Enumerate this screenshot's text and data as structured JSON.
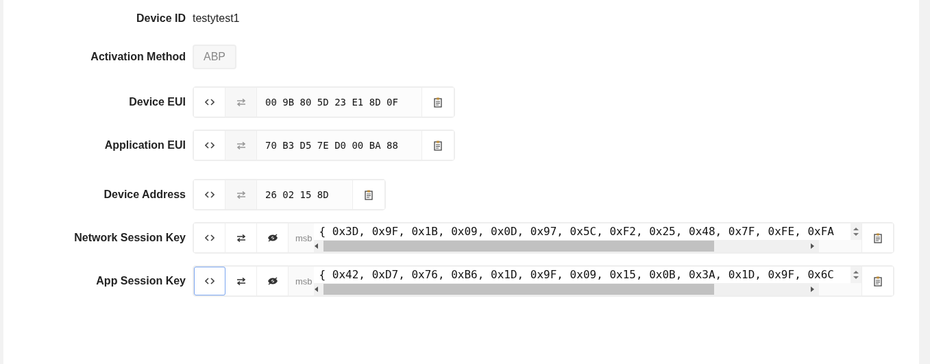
{
  "sections": [
    [
      {
        "kind": "text",
        "label": "Device ID",
        "value": "testytest1"
      }
    ],
    [
      {
        "kind": "badge",
        "label": "Activation Method",
        "value": "ABP",
        "disabled": true
      }
    ],
    [
      {
        "kind": "hex",
        "label": "Device EUI",
        "value": "00 9B 80 5D 23 E1 8D 0F"
      },
      {
        "kind": "hex",
        "label": "Application EUI",
        "value": "70 B3 D5 7E D0 00 BA 88"
      }
    ],
    [
      {
        "kind": "hex",
        "label": "Device Address",
        "value": "26 02 15 8D"
      },
      {
        "kind": "key",
        "label": "Network Session Key",
        "order": "msb",
        "value": "{ 0x3D, 0x9F, 0x1B, 0x09, 0x0D, 0x97, 0x5C, 0xF2, 0x25, 0x48, 0x7F, 0xFE, 0xFA",
        "focused": false
      },
      {
        "kind": "key",
        "label": "App Session Key",
        "order": "msb",
        "value": "{ 0x42, 0xD7, 0x76, 0xB6, 0x1D, 0x9F, 0x09, 0x15, 0x0B, 0x3A, 0x1D, 0x9F, 0x6C",
        "focused": true
      }
    ]
  ]
}
